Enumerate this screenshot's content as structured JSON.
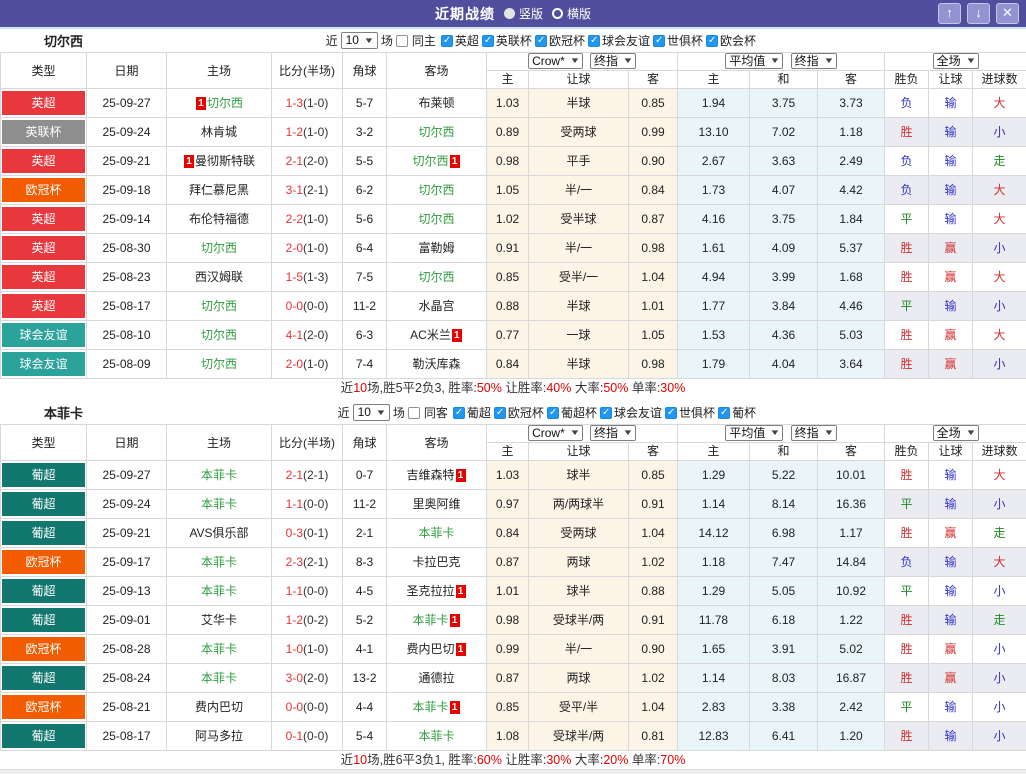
{
  "titlebar": {
    "title": "近期战绩",
    "radios": [
      {
        "label": "竖版",
        "selected": true
      },
      {
        "label": "横版",
        "selected": false
      }
    ],
    "icons": {
      "up": "↑",
      "down": "↓",
      "close": "✕"
    }
  },
  "colors": {
    "titlebar_bg": "#4f4f9e",
    "tracked_team_green": "#2f9e3f",
    "score_red": "#e63333",
    "rank_badge_red": "#e60000",
    "crow_col_bg": "#fcf4e6",
    "avg_col_bg": "#e9f5f9",
    "alt_result_bg": "#ebebf2"
  },
  "league_colors": {
    "英超": "#e8383d",
    "英联杯": "#8e8e8e",
    "欧冠杯": "#f35b00",
    "球会友谊": "#2ba39b",
    "葡超": "#12776f"
  },
  "result_colors": {
    "r": "#d42f2f",
    "b": "#3232cd",
    "g": "#1e8b22"
  },
  "sections": [
    {
      "team": "切尔西",
      "filter": {
        "prefix": "近",
        "count": "10",
        "suffix": "场",
        "same_label": "同主",
        "same_checked": false,
        "leagues": [
          {
            "label": "英超",
            "checked": true
          },
          {
            "label": "英联杯",
            "checked": true
          },
          {
            "label": "欧冠杯",
            "checked": true
          },
          {
            "label": "球会友谊",
            "checked": true
          },
          {
            "label": "世俱杯",
            "checked": true
          },
          {
            "label": "欧会杯",
            "checked": true
          }
        ]
      },
      "columns": {
        "type": "类型",
        "date": "日期",
        "home": "主场",
        "score": "比分(半场)",
        "corner": "角球",
        "away": "客场",
        "sub": [
          "主",
          "让球",
          "客",
          "主",
          "和",
          "客",
          "胜负",
          "让球",
          "进球数"
        ]
      },
      "selects": [
        "Crow*",
        "终指",
        "平均值",
        "终指",
        "全场"
      ],
      "rows": [
        {
          "league": "英超",
          "date": "25-09-27",
          "home": {
            "n": "切尔西",
            "t": 1,
            "b": "pre"
          },
          "score": "1-3",
          "half": "(1-0)",
          "corner": "5-7",
          "away": {
            "n": "布莱顿"
          },
          "crow": [
            "1.03",
            "半球",
            "0.85"
          ],
          "avg": [
            "1.94",
            "3.75",
            "3.73"
          ],
          "res": [
            [
              "负",
              "b"
            ],
            [
              "输",
              "b"
            ],
            [
              "大",
              "r"
            ]
          ]
        },
        {
          "league": "英联杯",
          "date": "25-09-24",
          "home": {
            "n": "林肯城"
          },
          "score": "1-2",
          "half": "(1-0)",
          "corner": "3-2",
          "away": {
            "n": "切尔西",
            "t": 1
          },
          "crow": [
            "0.89",
            "受两球",
            "0.99"
          ],
          "avg": [
            "13.10",
            "7.02",
            "1.18"
          ],
          "res": [
            [
              "胜",
              "r"
            ],
            [
              "输",
              "b"
            ],
            [
              "小",
              "b"
            ]
          ]
        },
        {
          "league": "英超",
          "date": "25-09-21",
          "home": {
            "n": "曼彻斯特联",
            "b": "pre"
          },
          "score": "2-1",
          "half": "(2-0)",
          "corner": "5-5",
          "away": {
            "n": "切尔西",
            "t": 1,
            "b": "post"
          },
          "crow": [
            "0.98",
            "平手",
            "0.90"
          ],
          "avg": [
            "2.67",
            "3.63",
            "2.49"
          ],
          "res": [
            [
              "负",
              "b"
            ],
            [
              "输",
              "b"
            ],
            [
              "走",
              "g"
            ]
          ]
        },
        {
          "league": "欧冠杯",
          "date": "25-09-18",
          "home": {
            "n": "拜仁慕尼黑"
          },
          "score": "3-1",
          "half": "(2-1)",
          "corner": "6-2",
          "away": {
            "n": "切尔西",
            "t": 1
          },
          "crow": [
            "1.05",
            "半/一",
            "0.84"
          ],
          "avg": [
            "1.73",
            "4.07",
            "4.42"
          ],
          "res": [
            [
              "负",
              "b"
            ],
            [
              "输",
              "b"
            ],
            [
              "大",
              "r"
            ]
          ]
        },
        {
          "league": "英超",
          "date": "25-09-14",
          "home": {
            "n": "布伦特福德"
          },
          "score": "2-2",
          "half": "(1-0)",
          "corner": "5-6",
          "away": {
            "n": "切尔西",
            "t": 1
          },
          "crow": [
            "1.02",
            "受半球",
            "0.87"
          ],
          "avg": [
            "4.16",
            "3.75",
            "1.84"
          ],
          "res": [
            [
              "平",
              "g"
            ],
            [
              "输",
              "b"
            ],
            [
              "大",
              "r"
            ]
          ]
        },
        {
          "league": "英超",
          "date": "25-08-30",
          "home": {
            "n": "切尔西",
            "t": 1
          },
          "score": "2-0",
          "half": "(1-0)",
          "corner": "6-4",
          "away": {
            "n": "富勒姆"
          },
          "crow": [
            "0.91",
            "半/一",
            "0.98"
          ],
          "avg": [
            "1.61",
            "4.09",
            "5.37"
          ],
          "res": [
            [
              "胜",
              "r"
            ],
            [
              "赢",
              "r"
            ],
            [
              "小",
              "b"
            ]
          ]
        },
        {
          "league": "英超",
          "date": "25-08-23",
          "home": {
            "n": "西汉姆联"
          },
          "score": "1-5",
          "half": "(1-3)",
          "corner": "7-5",
          "away": {
            "n": "切尔西",
            "t": 1
          },
          "crow": [
            "0.85",
            "受半/一",
            "1.04"
          ],
          "avg": [
            "4.94",
            "3.99",
            "1.68"
          ],
          "res": [
            [
              "胜",
              "r"
            ],
            [
              "赢",
              "r"
            ],
            [
              "大",
              "r"
            ]
          ]
        },
        {
          "league": "英超",
          "date": "25-08-17",
          "home": {
            "n": "切尔西",
            "t": 1
          },
          "score": "0-0",
          "half": "(0-0)",
          "corner": "11-2",
          "away": {
            "n": "水晶宫"
          },
          "crow": [
            "0.88",
            "半球",
            "1.01"
          ],
          "avg": [
            "1.77",
            "3.84",
            "4.46"
          ],
          "res": [
            [
              "平",
              "g"
            ],
            [
              "输",
              "b"
            ],
            [
              "小",
              "b"
            ]
          ]
        },
        {
          "league": "球会友谊",
          "date": "25-08-10",
          "home": {
            "n": "切尔西",
            "t": 1
          },
          "score": "4-1",
          "half": "(2-0)",
          "corner": "6-3",
          "away": {
            "n": "AC米兰",
            "b": "post"
          },
          "crow": [
            "0.77",
            "一球",
            "1.05"
          ],
          "avg": [
            "1.53",
            "4.36",
            "5.03"
          ],
          "res": [
            [
              "胜",
              "r"
            ],
            [
              "赢",
              "r"
            ],
            [
              "大",
              "r"
            ]
          ]
        },
        {
          "league": "球会友谊",
          "date": "25-08-09",
          "home": {
            "n": "切尔西",
            "t": 1
          },
          "score": "2-0",
          "half": "(1-0)",
          "corner": "7-4",
          "away": {
            "n": "勒沃库森"
          },
          "crow": [
            "0.84",
            "半球",
            "0.98"
          ],
          "avg": [
            "1.79",
            "4.04",
            "3.64"
          ],
          "res": [
            [
              "胜",
              "r"
            ],
            [
              "赢",
              "r"
            ],
            [
              "小",
              "b"
            ]
          ]
        }
      ],
      "summary": [
        [
          "近",
          0
        ],
        [
          "10",
          1
        ],
        [
          "场,胜5平2负3, 胜率:",
          0
        ],
        [
          "50%",
          1
        ],
        [
          " 让胜率:",
          0
        ],
        [
          "40%",
          1
        ],
        [
          " 大率:",
          0
        ],
        [
          "50%",
          1
        ],
        [
          " 单率:",
          0
        ],
        [
          "30%",
          1
        ]
      ]
    },
    {
      "team": "本菲卡",
      "filter": {
        "prefix": "近",
        "count": "10",
        "suffix": "场",
        "same_label": "同客",
        "same_checked": false,
        "leagues": [
          {
            "label": "葡超",
            "checked": true
          },
          {
            "label": "欧冠杯",
            "checked": true
          },
          {
            "label": "葡超杯",
            "checked": true
          },
          {
            "label": "球会友谊",
            "checked": true
          },
          {
            "label": "世俱杯",
            "checked": true
          },
          {
            "label": "葡杯",
            "checked": true
          }
        ]
      },
      "columns": {
        "type": "类型",
        "date": "日期",
        "home": "主场",
        "score": "比分(半场)",
        "corner": "角球",
        "away": "客场",
        "sub": [
          "主",
          "让球",
          "客",
          "主",
          "和",
          "客",
          "胜负",
          "让球",
          "进球数"
        ]
      },
      "selects": [
        "Crow*",
        "终指",
        "平均值",
        "终指",
        "全场"
      ],
      "rows": [
        {
          "league": "葡超",
          "date": "25-09-27",
          "home": {
            "n": "本菲卡",
            "t": 1
          },
          "score": "2-1",
          "half": "(2-1)",
          "corner": "0-7",
          "away": {
            "n": "吉维森特",
            "b": "post"
          },
          "crow": [
            "1.03",
            "球半",
            "0.85"
          ],
          "avg": [
            "1.29",
            "5.22",
            "10.01"
          ],
          "res": [
            [
              "胜",
              "r"
            ],
            [
              "输",
              "b"
            ],
            [
              "大",
              "r"
            ]
          ]
        },
        {
          "league": "葡超",
          "date": "25-09-24",
          "home": {
            "n": "本菲卡",
            "t": 1
          },
          "score": "1-1",
          "half": "(0-0)",
          "corner": "11-2",
          "away": {
            "n": "里奥阿维"
          },
          "crow": [
            "0.97",
            "两/两球半",
            "0.91"
          ],
          "avg": [
            "1.14",
            "8.14",
            "16.36"
          ],
          "res": [
            [
              "平",
              "g"
            ],
            [
              "输",
              "b"
            ],
            [
              "小",
              "b"
            ]
          ]
        },
        {
          "league": "葡超",
          "date": "25-09-21",
          "home": {
            "n": "AVS俱乐部"
          },
          "score": "0-3",
          "half": "(0-1)",
          "corner": "2-1",
          "away": {
            "n": "本菲卡",
            "t": 1
          },
          "crow": [
            "0.84",
            "受两球",
            "1.04"
          ],
          "avg": [
            "14.12",
            "6.98",
            "1.17"
          ],
          "res": [
            [
              "胜",
              "r"
            ],
            [
              "赢",
              "r"
            ],
            [
              "走",
              "g"
            ]
          ]
        },
        {
          "league": "欧冠杯",
          "date": "25-09-17",
          "home": {
            "n": "本菲卡",
            "t": 1
          },
          "score": "2-3",
          "half": "(2-1)",
          "corner": "8-3",
          "away": {
            "n": "卡拉巴克"
          },
          "crow": [
            "0.87",
            "两球",
            "1.02"
          ],
          "avg": [
            "1.18",
            "7.47",
            "14.84"
          ],
          "res": [
            [
              "负",
              "b"
            ],
            [
              "输",
              "b"
            ],
            [
              "大",
              "r"
            ]
          ]
        },
        {
          "league": "葡超",
          "date": "25-09-13",
          "home": {
            "n": "本菲卡",
            "t": 1
          },
          "score": "1-1",
          "half": "(0-0)",
          "corner": "4-5",
          "away": {
            "n": "圣克拉拉",
            "b": "post"
          },
          "crow": [
            "1.01",
            "球半",
            "0.88"
          ],
          "avg": [
            "1.29",
            "5.05",
            "10.92"
          ],
          "res": [
            [
              "平",
              "g"
            ],
            [
              "输",
              "b"
            ],
            [
              "小",
              "b"
            ]
          ]
        },
        {
          "league": "葡超",
          "date": "25-09-01",
          "home": {
            "n": "艾华卡"
          },
          "score": "1-2",
          "half": "(0-2)",
          "corner": "5-2",
          "away": {
            "n": "本菲卡",
            "t": 1,
            "b": "post"
          },
          "crow": [
            "0.98",
            "受球半/两",
            "0.91"
          ],
          "avg": [
            "11.78",
            "6.18",
            "1.22"
          ],
          "res": [
            [
              "胜",
              "r"
            ],
            [
              "输",
              "b"
            ],
            [
              "走",
              "g"
            ]
          ]
        },
        {
          "league": "欧冠杯",
          "date": "25-08-28",
          "home": {
            "n": "本菲卡",
            "t": 1
          },
          "score": "1-0",
          "half": "(1-0)",
          "corner": "4-1",
          "away": {
            "n": "费内巴切",
            "b": "post"
          },
          "crow": [
            "0.99",
            "半/一",
            "0.90"
          ],
          "avg": [
            "1.65",
            "3.91",
            "5.02"
          ],
          "res": [
            [
              "胜",
              "r"
            ],
            [
              "赢",
              "r"
            ],
            [
              "小",
              "b"
            ]
          ]
        },
        {
          "league": "葡超",
          "date": "25-08-24",
          "home": {
            "n": "本菲卡",
            "t": 1
          },
          "score": "3-0",
          "half": "(2-0)",
          "corner": "13-2",
          "away": {
            "n": "通德拉"
          },
          "crow": [
            "0.87",
            "两球",
            "1.02"
          ],
          "avg": [
            "1.14",
            "8.03",
            "16.87"
          ],
          "res": [
            [
              "胜",
              "r"
            ],
            [
              "赢",
              "r"
            ],
            [
              "小",
              "b"
            ]
          ]
        },
        {
          "league": "欧冠杯",
          "date": "25-08-21",
          "home": {
            "n": "费内巴切"
          },
          "score": "0-0",
          "half": "(0-0)",
          "corner": "4-4",
          "away": {
            "n": "本菲卡",
            "t": 1,
            "b": "post"
          },
          "crow": [
            "0.85",
            "受平/半",
            "1.04"
          ],
          "avg": [
            "2.83",
            "3.38",
            "2.42"
          ],
          "res": [
            [
              "平",
              "g"
            ],
            [
              "输",
              "b"
            ],
            [
              "小",
              "b"
            ]
          ]
        },
        {
          "league": "葡超",
          "date": "25-08-17",
          "home": {
            "n": "阿马多拉"
          },
          "score": "0-1",
          "half": "(0-0)",
          "corner": "5-4",
          "away": {
            "n": "本菲卡",
            "t": 1
          },
          "crow": [
            "1.08",
            "受球半/两",
            "0.81"
          ],
          "avg": [
            "12.83",
            "6.41",
            "1.20"
          ],
          "res": [
            [
              "胜",
              "r"
            ],
            [
              "输",
              "b"
            ],
            [
              "小",
              "b"
            ]
          ]
        }
      ],
      "summary": [
        [
          "近",
          0
        ],
        [
          "10",
          1
        ],
        [
          "场,胜6平3负1, 胜率:",
          0
        ],
        [
          "60%",
          1
        ],
        [
          " 让胜率:",
          0
        ],
        [
          "30%",
          1
        ],
        [
          " 大率:",
          0
        ],
        [
          "20%",
          1
        ],
        [
          " 单率:",
          0
        ],
        [
          "70%",
          1
        ]
      ]
    }
  ]
}
